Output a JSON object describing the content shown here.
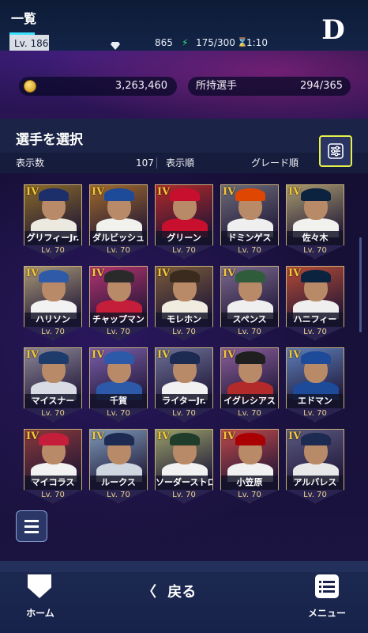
{
  "header": {
    "title": "一覧",
    "level_label": "Lv. 186",
    "gems": "865",
    "stamina": "175/300",
    "timer": "1:10",
    "team_logo": "D",
    "coins": "3,263,460",
    "owned_label": "所持選手",
    "owned_value": "294/365"
  },
  "section": {
    "title": "選手を選択",
    "count_label": "表示数",
    "count_value": "107",
    "order_label": "表示順",
    "order_value": "グレード順"
  },
  "cards": [
    {
      "grade": "IV",
      "name": "グリフィーJr.",
      "level": "Lv. 70",
      "bg": "#8a6a2a",
      "cap": "#1d2f6b",
      "body": "#ece9e0"
    },
    {
      "grade": "IV",
      "name": "ダルビッシュ",
      "level": "Lv. 70",
      "bg": "#a06a2c",
      "cap": "#1e4a9a",
      "body": "#f1f1ee"
    },
    {
      "grade": "IV",
      "name": "グリーン",
      "level": "Lv. 70",
      "bg": "#b22a2a",
      "cap": "#c8102e",
      "body": "#c8102e"
    },
    {
      "grade": "IV",
      "name": "ドミンゲス",
      "level": "Lv. 70",
      "bg": "#6d6b78",
      "cap": "#df4601",
      "body": "#efefef"
    },
    {
      "grade": "IV",
      "name": "佐々木",
      "level": "Lv. 70",
      "bg": "#a89a6e",
      "cap": "#0c2340",
      "body": "#f1f1ee"
    },
    {
      "grade": "IV",
      "name": "ハリソン",
      "level": "Lv. 70",
      "bg": "#a99877",
      "cap": "#2f5aa8",
      "body": "#f2f2f2"
    },
    {
      "grade": "IV",
      "name": "チャップマン",
      "level": "Lv. 70",
      "bg": "#b3346f",
      "cap": "#2a2a2a",
      "body": "#c41e3a"
    },
    {
      "grade": "IV",
      "name": "モレホン",
      "level": "Lv. 70",
      "bg": "#7a5b3a",
      "cap": "#3a2b1e",
      "body": "#f1ece0"
    },
    {
      "grade": "IV",
      "name": "スペンス",
      "level": "Lv. 70",
      "bg": "#7d6a8e",
      "cap": "#2f5c3a",
      "body": "#efefef"
    },
    {
      "grade": "IV",
      "name": "ハニフィー",
      "level": "Lv. 70",
      "bg": "#b64b36",
      "cap": "#0c2340",
      "body": "#efefef"
    },
    {
      "grade": "IV",
      "name": "マイスナー",
      "level": "Lv. 70",
      "bg": "#8f8897",
      "cap": "#1d3b6b",
      "body": "#d8dbe3"
    },
    {
      "grade": "IV",
      "name": "千賀",
      "level": "Lv. 70",
      "bg": "#7c5fa8",
      "cap": "#2d5aa8",
      "body": "#2d5aa8"
    },
    {
      "grade": "IV",
      "name": "ライターJr.",
      "level": "Lv. 70",
      "bg": "#6e7196",
      "cap": "#1d2a52",
      "body": "#f1f1f1"
    },
    {
      "grade": "IV",
      "name": "イグレシアス",
      "level": "Lv. 70",
      "bg": "#8a5f9a",
      "cap": "#1f1f1f",
      "body": "#b22a2a"
    },
    {
      "grade": "IV",
      "name": "エドマン",
      "level": "Lv. 70",
      "bg": "#5f7fb8",
      "cap": "#1e4a9a",
      "body": "#1e4a9a"
    },
    {
      "grade": "IV",
      "name": "マイコラス",
      "level": "Lv. 70",
      "bg": "#8a3a3a",
      "cap": "#c41e3a",
      "body": "#f2f2f2"
    },
    {
      "grade": "IV",
      "name": "ルークス",
      "level": "Lv. 70",
      "bg": "#7f9ab8",
      "cap": "#1d2a52",
      "body": "#cfd6e0"
    },
    {
      "grade": "IV",
      "name": "ソーダーストロム",
      "level": "Lv. 70",
      "bg": "#9aa06a",
      "cap": "#1f3d2a",
      "body": "#f1f1f1"
    },
    {
      "grade": "IV",
      "name": "小笠原",
      "level": "Lv. 70",
      "bg": "#c04a4a",
      "cap": "#ab0003",
      "body": "#f1f1f1"
    },
    {
      "grade": "IV",
      "name": "アルバレス",
      "level": "Lv. 70",
      "bg": "#5c5a80",
      "cap": "#1d2a52",
      "body": "#e8e8e8"
    }
  ],
  "nav": {
    "home_label": "ホーム",
    "back_label": "戻る",
    "menu_label": "メニュー"
  },
  "colors": {
    "accent": "#e6f24a",
    "grade": "#f4c73a",
    "stamina": "#35e37a"
  }
}
